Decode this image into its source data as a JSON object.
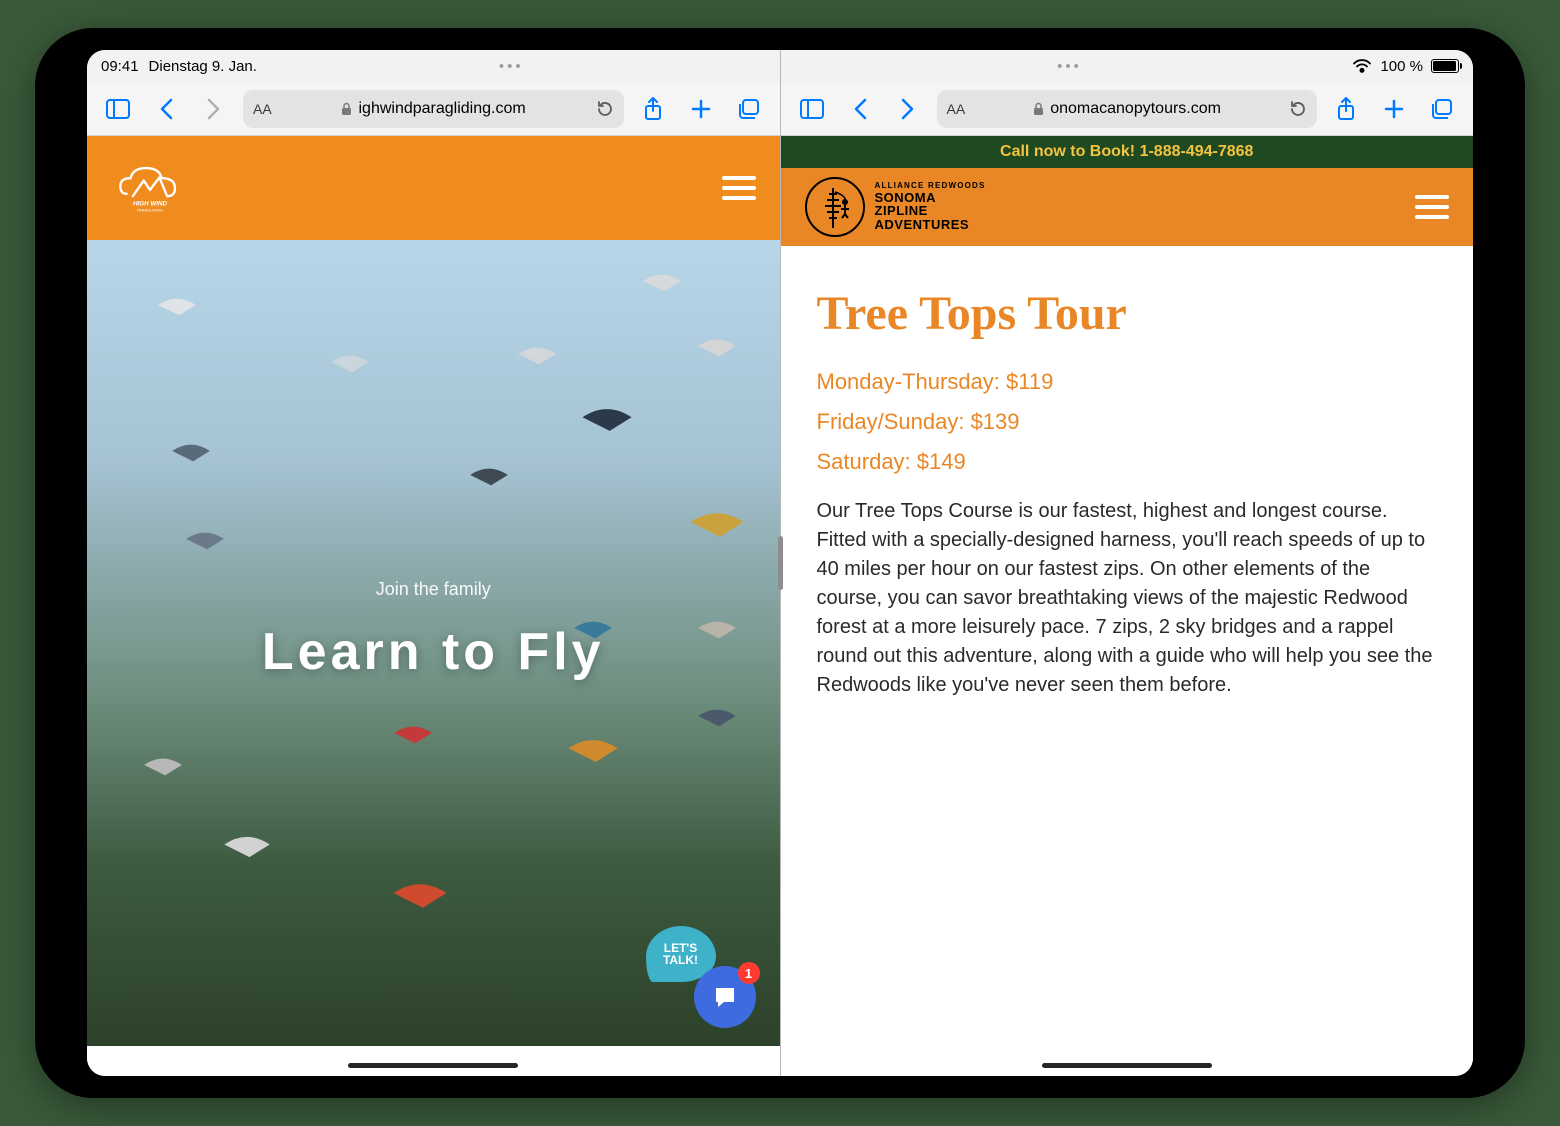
{
  "statusBar": {
    "time": "09:41",
    "date": "Dienstag 9. Jan.",
    "battery": "100 %"
  },
  "left": {
    "toolbar": {
      "url": "ighwindparagliding.com"
    },
    "hero": {
      "tagline": "Join the family",
      "headline": "Learn to Fly"
    },
    "chat": {
      "letsTalk": "LET'S TALK!",
      "badge": "1"
    }
  },
  "right": {
    "toolbar": {
      "url": "onomacanopytours.com"
    },
    "banner": "Call now to Book! 1-888-494-7868",
    "logo": {
      "top": "ALLIANCE REDWOODS",
      "l1": "SONOMA",
      "l2": "ZIPLINE",
      "l3": "ADVENTURES"
    },
    "content": {
      "title": "Tree Tops Tour",
      "prices": {
        "p1": "Monday-Thursday: $119",
        "p2": "Friday/Sunday: $139",
        "p3": "Saturday: $149"
      },
      "body": "Our Tree Tops Course is our fastest, highest and longest course. Fitted with a specially-designed harness, you'll reach speeds of up to 40 miles per hour on our fastest zips. On other elements of the course, you can savor breathtaking views of the majestic Redwood forest at a more leisurely pace. 7 zips, 2 sky bridges and a rappel round out this adventure, along with a guide who will help you see the Redwoods like you've never seen them before."
    }
  }
}
